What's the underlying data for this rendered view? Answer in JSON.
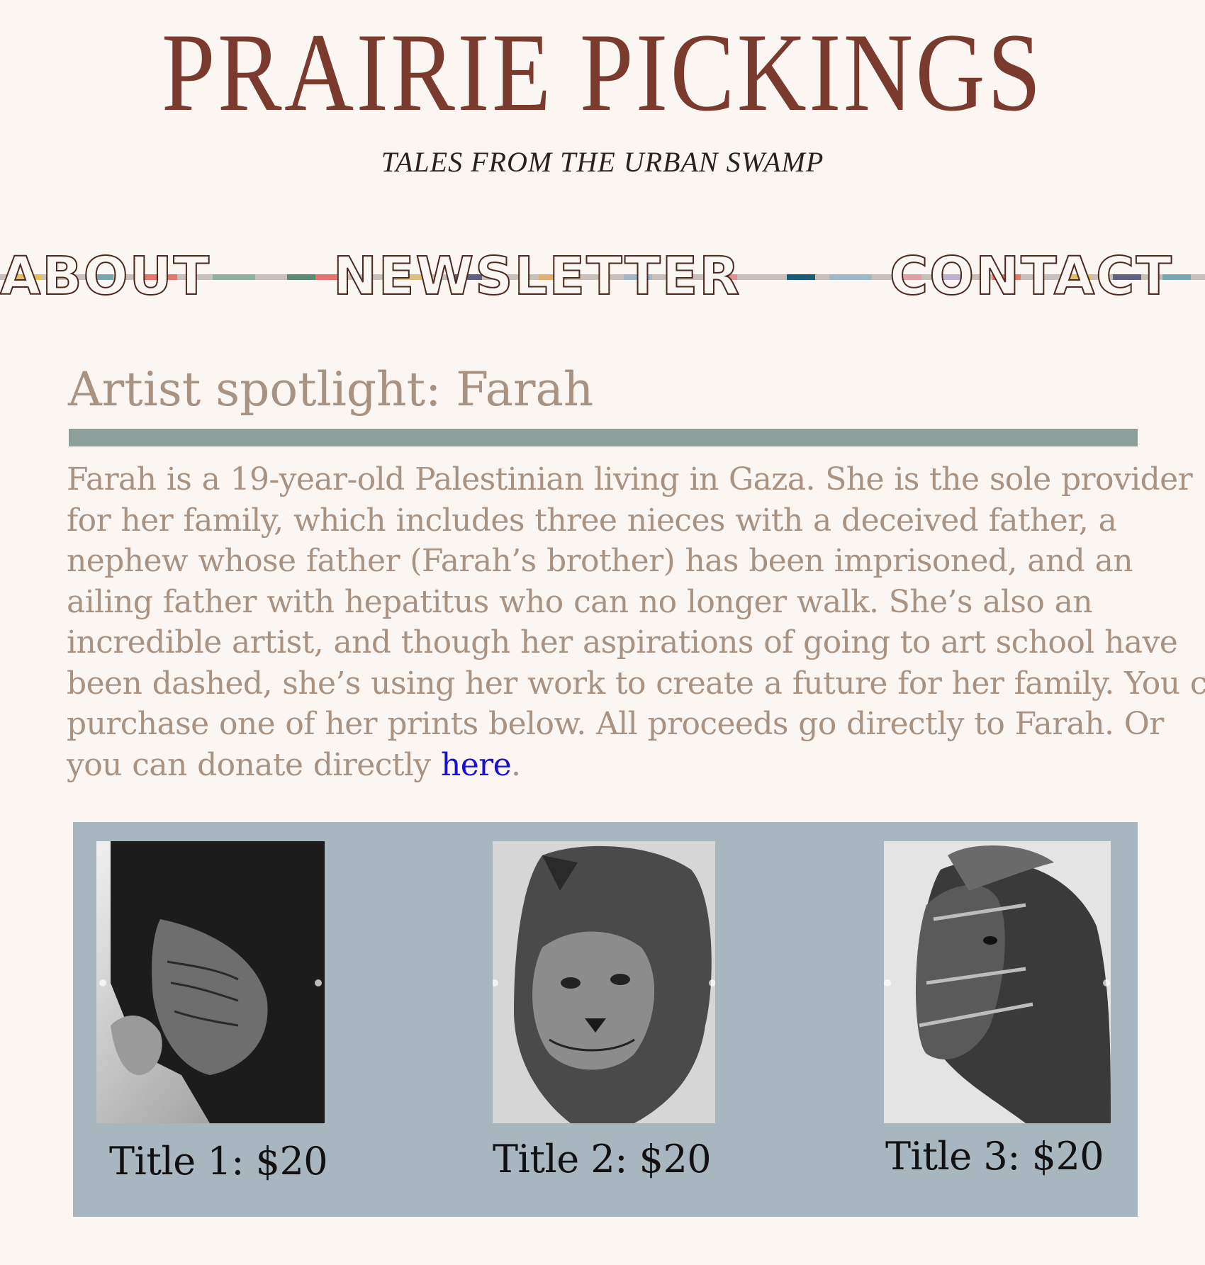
{
  "header": {
    "site_title": "PRAIRIE PICKINGS",
    "tagline": "TALES FROM THE URBAN SWAMP"
  },
  "nav": {
    "items": [
      {
        "label": "ABOUT"
      },
      {
        "label": "NEWSLETTER"
      },
      {
        "label": "CONTACT"
      }
    ]
  },
  "article": {
    "title": "Artist spotlight: Farah",
    "body_lines": [
      "Farah is a 19-year-old Palestinian living in Gaza. She is the sole provider",
      "for her family, which includes three nieces with a deceived father, a",
      "nephew whose father (Farah’s brother) has been imprisoned, and an",
      "ailing father with hepatitus who can no longer walk. She’s also an",
      "incredible artist, and though her aspirations of going to art school have",
      "been dashed, she’s using her work to create a future for her family. You can",
      "purchase one of her prints below. All proceeds go directly to Farah. Or",
      "you can donate directly "
    ],
    "link_text": "here",
    "after_link": "."
  },
  "gallery": {
    "prints": [
      {
        "caption": "Title 1: $20",
        "image_icon": "elderly-woman-drawing"
      },
      {
        "caption": "Title 2: $20",
        "image_icon": "lioness-drawing"
      },
      {
        "caption": "Title 3: $20",
        "image_icon": "horse-drawing"
      }
    ]
  },
  "colors": {
    "background": "#fcf6f2",
    "title": "#7a3b2e",
    "article_text": "#a89282",
    "rule": "#8c9f9a",
    "gallery_bg": "#a8b6bf",
    "link": "#1a0fcc"
  }
}
